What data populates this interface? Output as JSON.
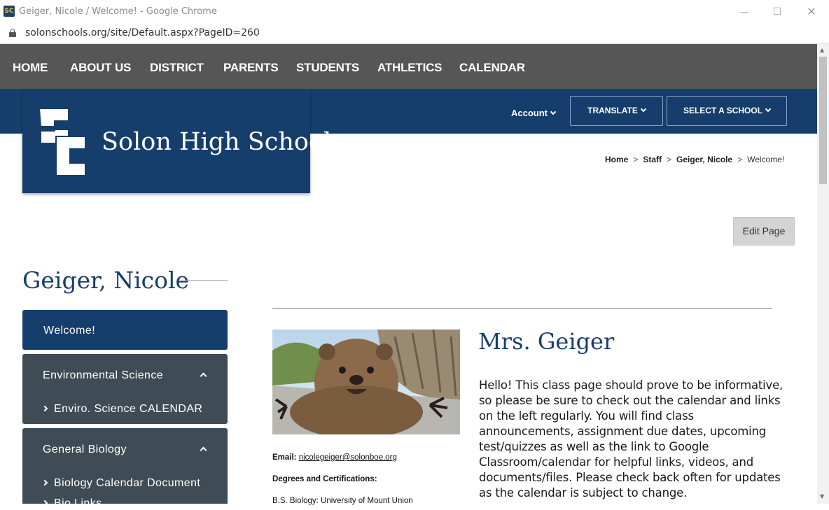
{
  "browser": {
    "favicon_text": "SC",
    "window_title": "Geiger, Nicole / Welcome! - Google Chrome",
    "url": "solonschools.org/site/Default.aspx?PageID=260",
    "minimize_glyph": "—",
    "maximize_glyph": "☐",
    "close_glyph": "✕"
  },
  "nav": {
    "items": [
      "HOME",
      "ABOUT US",
      "DISTRICT",
      "PARENTS",
      "STUDENTS",
      "ATHLETICS",
      "CALENDAR"
    ]
  },
  "header": {
    "account_label": "Account",
    "translate_label": "TRANSLATE",
    "select_school_label": "SELECT A SCHOOL",
    "school_name": "Solon High School",
    "logo_letters": "SC"
  },
  "breadcrumb": {
    "items": [
      "Home",
      "Staff",
      "Geiger, Nicole"
    ],
    "current": "Welcome!",
    "separator": ">"
  },
  "edit_page_label": "Edit Page",
  "page_heading": "Geiger, Nicole",
  "sidebar": {
    "welcome": "Welcome!",
    "groups": [
      {
        "title": "Environmental Science",
        "items": [
          "Enviro. Science CALENDAR"
        ]
      },
      {
        "title": "General Biology",
        "items": [
          "Biology Calendar Document",
          "Bio Links"
        ]
      }
    ]
  },
  "main": {
    "teacher_name": "Mrs. Geiger",
    "intro": "Hello!  This class page should prove to be informative, so please be sure to check out the calendar and links on the left regularly. You will find class announcements, assignment due dates, upcoming test/quizzes as well as the link to Google Classroom/calendar for helpful links, videos, and documents/files.  Please check back often for updates as the calendar is subject to change.",
    "email_label": "Email:",
    "email": "nicolegeiger@solonboe.org",
    "degrees_label": "Degrees and Certifications:",
    "degrees": [
      "B.S. Biology: University of Mount Union"
    ]
  },
  "colors": {
    "nav_gray": "#565656",
    "brand_blue": "#163e6c",
    "sidebar_slate": "#3f4c55"
  }
}
